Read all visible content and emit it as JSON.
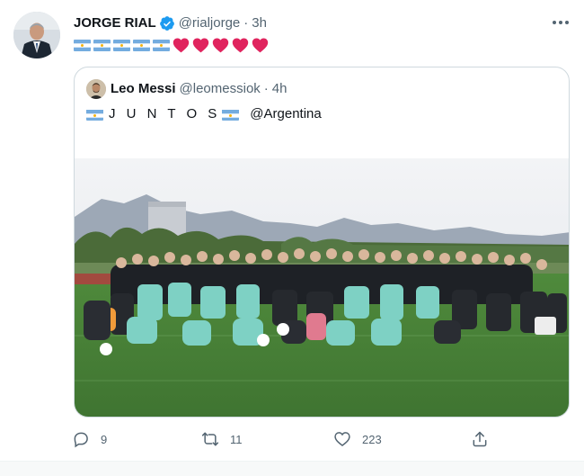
{
  "author": {
    "name": "JORGE RIAL",
    "handle": "@rialjorge",
    "separator": "·",
    "time": "3h",
    "verified": true
  },
  "tweet_body": {
    "flags": 5,
    "hearts": 5,
    "flag_icon": "argentina-flag-emoji",
    "heart_icon": "red-heart-emoji",
    "heart_color": "#e0245e"
  },
  "quoted": {
    "name": "Leo Messi",
    "handle": "@leomessiok",
    "separator": "·",
    "time": "4h",
    "text_word": "J U N T O S",
    "mention": "@Argentina"
  },
  "actions": {
    "reply_count": "9",
    "retweet_count": "11",
    "like_count": "223"
  },
  "colors": {
    "accent": "#1d9bf0",
    "secondary_text": "#536471",
    "border": "#cfd9de",
    "flag_blue": "#74acdf",
    "flag_sun": "#f6b40e"
  }
}
